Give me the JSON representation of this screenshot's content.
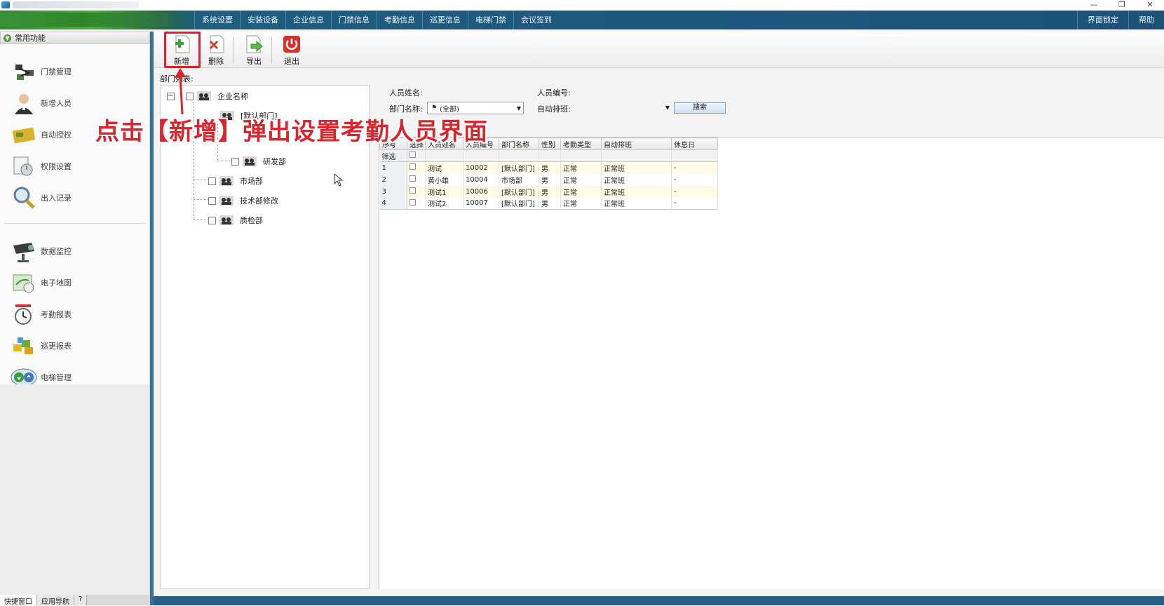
{
  "window": {
    "controls": [
      "—",
      "❐",
      "✕"
    ]
  },
  "menu": {
    "items": [
      "系统设置",
      "安装设备",
      "企业信息",
      "门禁信息",
      "考勤信息",
      "巡更信息",
      "电梯门禁",
      "会议签到"
    ],
    "right_items": [
      "界面锁定",
      "帮助"
    ]
  },
  "sidebar": {
    "header": "常用功能",
    "group1": [
      "门禁管理",
      "新增人员",
      "自动授权",
      "权限设置",
      "出入记录"
    ],
    "group2": [
      "数据监控",
      "电子地图",
      "考勤报表",
      "巡更报表",
      "电梯管理"
    ]
  },
  "bottom_tabs": [
    "快捷窗口",
    "应用导航",
    "?"
  ],
  "toolbar": {
    "add": "新增",
    "delete": "删除",
    "export": "导出",
    "exit": "退出"
  },
  "dept_panel": {
    "label": "部门列表:",
    "root": "企业名称",
    "nodes": [
      "[默认部门]",
      "研发部",
      "市场部",
      "技术部修改",
      "质检部"
    ]
  },
  "search": {
    "name_label": "人员姓名:",
    "id_label": "人员编号:",
    "dept_label": "部门名称:",
    "dept_value": "(全部)",
    "auto_label": "自动排班:",
    "button": "搜索"
  },
  "grid": {
    "headers": [
      "序号",
      "选择",
      "人员姓名",
      "人员编号",
      "部门名称",
      "性别",
      "考勤类型",
      "自动排班",
      "休息日"
    ],
    "filter_label": "筛选",
    "rows": [
      [
        "1",
        "测试",
        "10002",
        "[默认部门]",
        "男",
        "正常",
        "正常班",
        "-"
      ],
      [
        "2",
        "黄小雄",
        "10004",
        "市场部",
        "男",
        "正常",
        "正常班",
        "-"
      ],
      [
        "3",
        "测试1",
        "10006",
        "[默认部门]",
        "男",
        "正常",
        "正常班",
        "-"
      ],
      [
        "4",
        "测试2",
        "10007",
        "[默认部门]",
        "男",
        "正常",
        "正常班",
        "-"
      ]
    ]
  },
  "annotation": {
    "text": "点击【新增】弹出设置考勤人员界面",
    "color": "#d9262e"
  }
}
